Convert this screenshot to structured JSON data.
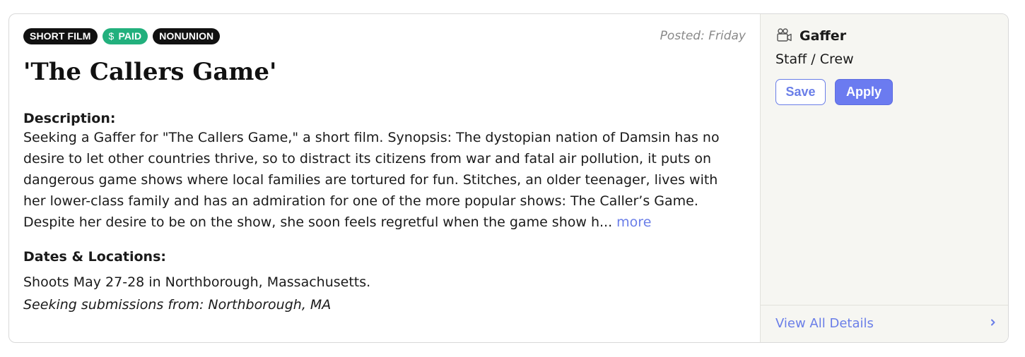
{
  "tags": [
    {
      "label": "SHORT FILM"
    },
    {
      "label": "PAID",
      "icon": "$"
    },
    {
      "label": "NONUNION"
    }
  ],
  "posted": "Posted: Friday",
  "title": "'The Callers Game'",
  "description": {
    "label": "Description:",
    "lines": [
      "Seeking a Gaffer for \"The Callers Game,\" a short film. Synopsis: The dystopian nation of Damsin has no",
      "desire to let other countries thrive, so to distract its citizens from war and fatal air pollution, it puts on",
      "dangerous game shows where local families are tortured for fun. Stitches, an older teenager, lives with",
      "her lower-class family and has an admiration for one of the more popular shows: The Caller’s Game.",
      "Despite her desire to be on the show, she soon feels regretful when the game show h..."
    ],
    "more": "more"
  },
  "dates": {
    "label": "Dates & Locations:",
    "shoots": "Shoots May 27-28 in Northborough, Massachusetts.",
    "seeking": "Seeking submissions from: Northborough, MA"
  },
  "role": {
    "icon": "camera-icon",
    "name": "Gaffer",
    "type": "Staff / Crew"
  },
  "buttons": {
    "save": "Save",
    "apply": "Apply"
  },
  "footer": {
    "view_all": "View All Details",
    "icon": "chevron-right-icon"
  },
  "colors": {
    "accent": "#6a7ee8",
    "paid": "#22b07d",
    "tag": "#111111",
    "side_bg": "#f6f6f2"
  }
}
